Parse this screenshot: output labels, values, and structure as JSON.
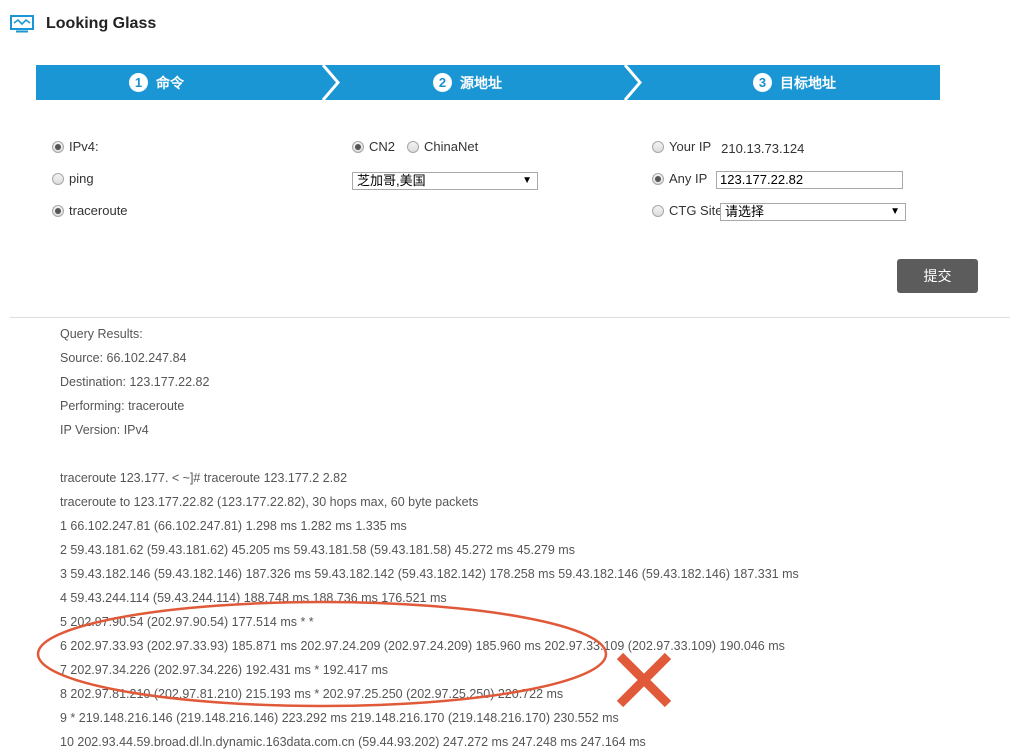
{
  "header": {
    "title": "Looking Glass",
    "icon": "monitor-icon"
  },
  "steps": [
    {
      "num": "1",
      "label": "命令"
    },
    {
      "num": "2",
      "label": "源地址"
    },
    {
      "num": "3",
      "label": "目标地址"
    }
  ],
  "colors": {
    "step_bar": "#1a96d4",
    "button": "#5c5c5c",
    "annotation": "#e05a3a"
  },
  "command": {
    "ipv4_label": "IPv4:",
    "ping_label": "ping",
    "traceroute_label": "traceroute"
  },
  "source": {
    "cn2_label": "CN2",
    "chinanet_label": "ChinaNet",
    "location_selected": "芝加哥,美国"
  },
  "target": {
    "your_ip_label": "Your IP",
    "your_ip_value": "210.13.73.124",
    "any_ip_label": "Any IP",
    "any_ip_value": "123.177.22.82",
    "ctg_site_label": "CTG Site",
    "ctg_site_selected": "请选择"
  },
  "submit_label": "提交",
  "results": {
    "lines": [
      "Query Results:",
      "Source: 66.102.247.84",
      "Destination: 123.177.22.82",
      "Performing: traceroute",
      "IP Version: IPv4",
      "",
      "traceroute 123.177. < ~]# traceroute 123.177.2 2.82",
      "traceroute to 123.177.22.82 (123.177.22.82), 30 hops max, 60 byte packets",
      "1 66.102.247.81 (66.102.247.81) 1.298 ms 1.282 ms 1.335 ms",
      "2 59.43.181.62 (59.43.181.62) 45.205 ms 59.43.181.58 (59.43.181.58) 45.272 ms 45.279 ms",
      "3 59.43.182.146 (59.43.182.146) 187.326 ms 59.43.182.142 (59.43.182.142) 178.258 ms 59.43.182.146 (59.43.182.146) 187.331 ms",
      "4 59.43.244.114 (59.43.244.114) 188.748 ms 188.736 ms 176.521 ms",
      "5 202.97.90.54 (202.97.90.54) 177.514 ms * *",
      "6 202.97.33.93 (202.97.33.93) 185.871 ms 202.97.24.209 (202.97.24.209) 185.960 ms 202.97.33.109 (202.97.33.109) 190.046 ms",
      "7 202.97.34.226 (202.97.34.226) 192.431 ms * 192.417 ms",
      "8 202.97.81.210 (202.97.81.210) 215.193 ms * 202.97.25.250 (202.97.25.250) 220.722 ms",
      "9 * 219.148.216.146 (219.148.216.146) 223.292 ms 219.148.216.170 (219.148.216.170) 230.552 ms",
      "10 202.93.44.59.broad.dl.ln.dynamic.163data.com.cn (59.44.93.202) 247.272 ms 247.248 ms 247.164 ms"
    ]
  }
}
